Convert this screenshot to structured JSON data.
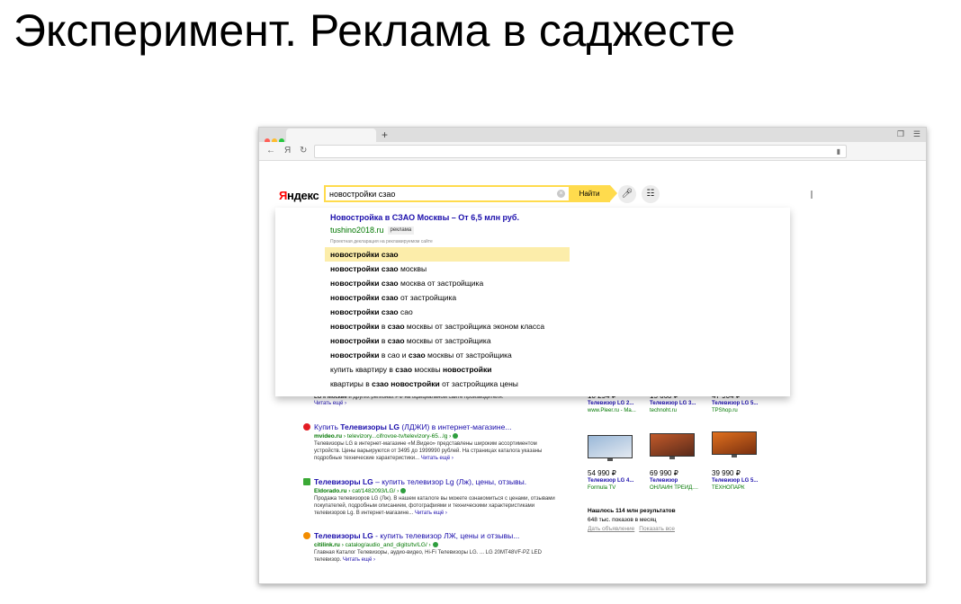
{
  "slide": {
    "title": "Эксперимент. Реклама в саджесте"
  },
  "browser": {
    "new_tab_symbol": "+",
    "nav": {
      "back": "←",
      "ya": "Я",
      "reload": "↻"
    }
  },
  "yandex": {
    "logo": {
      "first": "Я",
      "rest": "ндекс"
    },
    "search": {
      "value": "новостройки сзао",
      "find_label": "Найти"
    }
  },
  "suggest": {
    "ad": {
      "title": "Новостройка в СЗАО Москвы – От 6,5 млн руб.",
      "domain": "tushino2018.ru",
      "badge": "реклама",
      "note": "Проектная декларация на рекламируемом сайте"
    },
    "items": [
      {
        "bold": "новостройки сзао",
        "rest": ""
      },
      {
        "bold": "новостройки сзао",
        "rest": " москвы"
      },
      {
        "bold": "новостройки сзао",
        "rest": " москва от застройщика"
      },
      {
        "bold": "новостройки сзао",
        "rest": " от застройщика"
      },
      {
        "bold": "новостройки сзао",
        "rest": " сао"
      },
      {
        "pre": "новостройки",
        "mid": " в ",
        "bold2": "сзао",
        "rest": " москвы от застройщика эконом класса"
      },
      {
        "pre": "новостройки",
        "mid": " в ",
        "bold2": "сзао",
        "rest": " москвы от застройщика"
      },
      {
        "pre": "новостройки",
        "mid": " в сао и ",
        "bold2": "сзао",
        "rest": " москвы от застройщика"
      },
      {
        "pre": "",
        "mid": "купить квартиру в ",
        "bold2": "сзао",
        "rest": " москвы ",
        "tail": "новостройки"
      },
      {
        "pre": "",
        "mid": "квартиры в ",
        "bold2": "сзао новостройки",
        "rest": " от застройщика цены"
      }
    ]
  },
  "results": {
    "partial_snippet_a": "LG",
    "partial_snippet_b": " в ",
    "partial_snippet_c": "Москве",
    "partial_snippet_d": " и других регионах РФ на официальном сайте производителя.",
    "partial_more": "Читать ещё ›",
    "items": [
      {
        "title_pre": "Купить ",
        "title_bold": "Телевизоры LG",
        "title_post": " (ЛДЖИ) в интернет-магазине...",
        "url_bold": "mvideo.ru",
        "url_rest": " › televizory...cifrovoe-tv/televizory-65...lg ›",
        "snippet": "Телевизоры LG в интернет-магазине «М.Видео» представлены широким ассортиментом устройств. Цены варьируются от 3495 до 1999990 рублей. На страницах каталога указаны подробные технические характеристики...",
        "more": "Читать ещё ›",
        "fav_color": "#e31b23"
      },
      {
        "title_pre": "",
        "title_bold": "Телевизоры LG",
        "title_post": " – купить телевизор Lg (Лж), цены, отзывы.",
        "url_bold": "Eldorado.ru",
        "url_rest": " › cat/1482093/LG/ ›",
        "snippet": "Продажа телевизоров LG (Лж). В нашем каталоге вы можете ознакомиться с ценами, отзывами покупателей, подробным описанием, фотографиями и техническими характеристиками телевизоров Lg. В интернет-магазине...",
        "more": "Читать ещё ›",
        "fav_color": "#3aa935"
      },
      {
        "title_pre": "",
        "title_bold": "Телевизоры LG",
        "title_post": " - купить телевизор ЛЖ, цены и отзывы...",
        "url_bold": "citilink.ru",
        "url_rest": " › catalog/audio_and_digits/tv/LG/ ›",
        "snippet": "Главная Каталог Телевизоры, аудио-видео, Hi-Fi Телевизоры LG. ... LG 20MT48VF-PZ LED телевизор.",
        "more": "Читать ещё ›",
        "fav_color": "#f28c00"
      }
    ]
  },
  "products": {
    "top_row": [
      {
        "price": "10 294 ₽",
        "name": "Телевизор LG 2...",
        "shop": "www.Pleer.ru - Ма..."
      },
      {
        "price": "15 660 ₽",
        "name": "Телевизор LG 3...",
        "shop": "technoht.ru"
      },
      {
        "price": "47 904 ₽",
        "name": "Телевизор LG 5...",
        "shop": "TPShop.ru"
      }
    ],
    "bottom_row": [
      {
        "price": "54 990 ₽",
        "name": "Телевизор LG 4...",
        "shop": "Formula TV",
        "screen_colors": [
          "#9ab8d8",
          "#e3e9f1"
        ]
      },
      {
        "price": "69 990 ₽",
        "name": "Телевизор",
        "shop": "ОНЛАЙН ТРЕЙД....",
        "screen_colors": [
          "#c25a2a",
          "#5a2a1a"
        ]
      },
      {
        "price": "39 990 ₽",
        "name": "Телевизор LG 5...",
        "shop": "ТЕХНОПАРК",
        "screen_colors": [
          "#e0701e",
          "#7a3010"
        ]
      }
    ],
    "found": "Нашлось 114 млн результатов",
    "shows": "648 тыс. показов в месяц",
    "link_ad": "Дать объявление",
    "link_all": "Показать все"
  }
}
